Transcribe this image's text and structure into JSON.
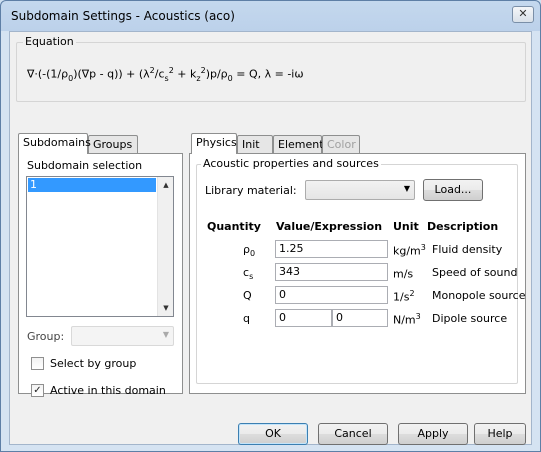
{
  "window": {
    "title": "Subdomain Settings - Acoustics (aco)",
    "close_glyph": "✕"
  },
  "equation": {
    "legend": "Equation",
    "text": "∇·(-(1/ρ₀)(∇p - q)) + (λ²/cₛ² + k_z²)p/ρ₀ = Q, λ = -iω"
  },
  "left_tabs": [
    "Subdomains",
    "Groups"
  ],
  "subdomain_selection": {
    "legend": "Subdomain selection",
    "items": [
      "1"
    ]
  },
  "group": {
    "label": "Group:",
    "value": ""
  },
  "checkboxes": {
    "select_by_group": {
      "label": "Select by group",
      "checked": false
    },
    "active_in_domain": {
      "label": "Active in this domain",
      "checked": true
    }
  },
  "right_tabs": [
    {
      "label": "Physics",
      "active": true,
      "disabled": false
    },
    {
      "label": "Init",
      "active": false,
      "disabled": false
    },
    {
      "label": "Element",
      "active": false,
      "disabled": false
    },
    {
      "label": "Color",
      "active": false,
      "disabled": true
    }
  ],
  "acoustic": {
    "legend": "Acoustic properties and sources",
    "library_label": "Library material:",
    "library_value": "",
    "load_button": "Load...",
    "headers": {
      "quantity": "Quantity",
      "value": "Value/Expression",
      "unit": "Unit",
      "description": "Description"
    },
    "rows": [
      {
        "symbol": "ρ",
        "sub": "0",
        "value": "1.25",
        "unit": "kg/m",
        "unit_sup": "3",
        "description": "Fluid density"
      },
      {
        "symbol": "c",
        "sub": "s",
        "value": "343",
        "unit": "m/s",
        "unit_sup": "",
        "description": "Speed of sound"
      },
      {
        "symbol": "Q",
        "sub": "",
        "value": "0",
        "unit": "1/s",
        "unit_sup": "2",
        "description": "Monopole source"
      },
      {
        "symbol": "q",
        "sub": "",
        "value": "0",
        "value2": "0",
        "unit": "N/m",
        "unit_sup": "3",
        "description": "Dipole source"
      }
    ]
  },
  "buttons": {
    "ok": "OK",
    "cancel": "Cancel",
    "apply": "Apply",
    "help": "Help"
  }
}
